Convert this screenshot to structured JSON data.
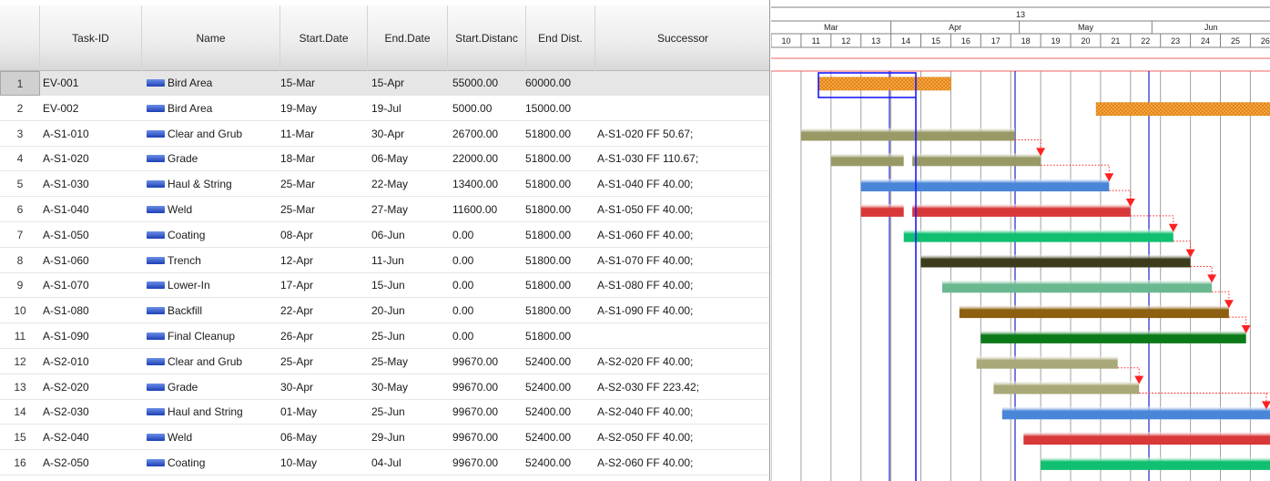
{
  "columns": {
    "task_id": "Task-ID",
    "name": "Name",
    "start_date": "Start.Date",
    "end_date": "End.Date",
    "start_dist": "Start.Distanc",
    "end_dist": "End Dist.",
    "successor": "Successor"
  },
  "timeline": {
    "year": "13",
    "months": [
      "Mar",
      "Apr",
      "May",
      "Jun"
    ],
    "weeks": [
      "10",
      "11",
      "12",
      "13",
      "14",
      "15",
      "16",
      "17",
      "18",
      "19",
      "20",
      "21",
      "22",
      "23",
      "24",
      "25",
      "26"
    ]
  },
  "rows": [
    {
      "num": "1",
      "task_id": "EV-001",
      "name": "Bird Area",
      "start": "15-Mar",
      "end": "15-Apr",
      "start_dist": "55000.00",
      "end_dist": "60000.00",
      "successor": ""
    },
    {
      "num": "2",
      "task_id": "EV-002",
      "name": "Bird Area",
      "start": "19-May",
      "end": "19-Jul",
      "start_dist": "5000.00",
      "end_dist": "15000.00",
      "successor": ""
    },
    {
      "num": "3",
      "task_id": "A-S1-010",
      "name": "Clear and Grub",
      "start": "11-Mar",
      "end": "30-Apr",
      "start_dist": "26700.00",
      "end_dist": "51800.00",
      "successor": "A-S1-020 FF 50.67;"
    },
    {
      "num": "4",
      "task_id": "A-S1-020",
      "name": "Grade",
      "start": "18-Mar",
      "end": "06-May",
      "start_dist": "22000.00",
      "end_dist": "51800.00",
      "successor": "A-S1-030 FF 110.67;"
    },
    {
      "num": "5",
      "task_id": "A-S1-030",
      "name": "Haul & String",
      "start": "25-Mar",
      "end": "22-May",
      "start_dist": "13400.00",
      "end_dist": "51800.00",
      "successor": "A-S1-040 FF 40.00;"
    },
    {
      "num": "6",
      "task_id": "A-S1-040",
      "name": "Weld",
      "start": "25-Mar",
      "end": "27-May",
      "start_dist": "11600.00",
      "end_dist": "51800.00",
      "successor": "A-S1-050 FF 40.00;"
    },
    {
      "num": "7",
      "task_id": "A-S1-050",
      "name": "Coating",
      "start": "08-Apr",
      "end": "06-Jun",
      "start_dist": "0.00",
      "end_dist": "51800.00",
      "successor": "A-S1-060 FF 40.00;"
    },
    {
      "num": "8",
      "task_id": "A-S1-060",
      "name": "Trench",
      "start": "12-Apr",
      "end": "11-Jun",
      "start_dist": "0.00",
      "end_dist": "51800.00",
      "successor": "A-S1-070 FF 40.00;"
    },
    {
      "num": "9",
      "task_id": "A-S1-070",
      "name": "Lower-In",
      "start": "17-Apr",
      "end": "15-Jun",
      "start_dist": "0.00",
      "end_dist": "51800.00",
      "successor": "A-S1-080 FF 40.00;"
    },
    {
      "num": "10",
      "task_id": "A-S1-080",
      "name": "Backfill",
      "start": "22-Apr",
      "end": "20-Jun",
      "start_dist": "0.00",
      "end_dist": "51800.00",
      "successor": "A-S1-090 FF 40.00;"
    },
    {
      "num": "11",
      "task_id": "A-S1-090",
      "name": "Final Cleanup",
      "start": "26-Apr",
      "end": "25-Jun",
      "start_dist": "0.00",
      "end_dist": "51800.00",
      "successor": ""
    },
    {
      "num": "12",
      "task_id": "A-S2-010",
      "name": "Clear and Grub",
      "start": "25-Apr",
      "end": "25-May",
      "start_dist": "99670.00",
      "end_dist": "52400.00",
      "successor": "A-S2-020 FF 40.00;"
    },
    {
      "num": "13",
      "task_id": "A-S2-020",
      "name": "Grade",
      "start": "30-Apr",
      "end": "30-May",
      "start_dist": "99670.00",
      "end_dist": "52400.00",
      "successor": "A-S2-030 FF 223.42;"
    },
    {
      "num": "14",
      "task_id": "A-S2-030",
      "name": "Haul and String",
      "start": "01-May",
      "end": "25-Jun",
      "start_dist": "99670.00",
      "end_dist": "52400.00",
      "successor": "A-S2-040 FF 40.00;"
    },
    {
      "num": "15",
      "task_id": "A-S2-040",
      "name": "Weld",
      "start": "06-May",
      "end": "29-Jun",
      "start_dist": "99670.00",
      "end_dist": "52400.00",
      "successor": "A-S2-050 FF 40.00;"
    },
    {
      "num": "16",
      "task_id": "A-S2-050",
      "name": "Coating",
      "start": "10-May",
      "end": "04-Jul",
      "start_dist": "99670.00",
      "end_dist": "52400.00",
      "successor": "A-S2-060 FF 40.00;"
    }
  ],
  "bars": [
    {
      "row": 0,
      "segments": [
        {
          "from": "15-Mar",
          "to": "15-Apr"
        }
      ],
      "color": "#f0a030",
      "style": "hatched"
    },
    {
      "row": 1,
      "segments": [
        {
          "from": "19-May",
          "to": "19-Jul"
        }
      ],
      "color": "#f0a030",
      "style": "hatched"
    },
    {
      "row": 2,
      "segments": [
        {
          "from": "11-Mar",
          "to": "30-Apr"
        }
      ],
      "color": "#999966"
    },
    {
      "row": 3,
      "segments": [
        {
          "from": "18-Mar",
          "to": "04-Apr"
        },
        {
          "from": "06-Apr",
          "to": "06-May"
        }
      ],
      "color": "#999966"
    },
    {
      "row": 4,
      "segments": [
        {
          "from": "25-Mar",
          "to": "22-May"
        }
      ],
      "color": "#4a86d8"
    },
    {
      "row": 5,
      "segments": [
        {
          "from": "25-Mar",
          "to": "04-Apr"
        },
        {
          "from": "06-Apr",
          "to": "27-May"
        }
      ],
      "color": "#d83838"
    },
    {
      "row": 6,
      "segments": [
        {
          "from": "04-Apr",
          "to": "06-Jun"
        }
      ],
      "color": "#10c070"
    },
    {
      "row": 7,
      "segments": [
        {
          "from": "08-Apr",
          "to": "10-Jun"
        }
      ],
      "color": "#3c3c1c"
    },
    {
      "row": 8,
      "segments": [
        {
          "from": "13-Apr",
          "to": "15-Jun"
        }
      ],
      "color": "#6ab890"
    },
    {
      "row": 9,
      "segments": [
        {
          "from": "17-Apr",
          "to": "19-Jun"
        }
      ],
      "color": "#8c6010"
    },
    {
      "row": 10,
      "segments": [
        {
          "from": "22-Apr",
          "to": "23-Jun"
        }
      ],
      "color": "#0c7a18"
    },
    {
      "row": 11,
      "segments": [
        {
          "from": "21-Apr",
          "to": "24-May"
        }
      ],
      "color": "#a8a878"
    },
    {
      "row": 12,
      "segments": [
        {
          "from": "25-Apr",
          "to": "29-May"
        }
      ],
      "color": "#a8a878"
    },
    {
      "row": 13,
      "segments": [
        {
          "from": "27-Apr",
          "to": "30-Jun"
        }
      ],
      "color": "#4a86d8"
    },
    {
      "row": 14,
      "segments": [
        {
          "from": "02-May",
          "to": "30-Jun"
        }
      ],
      "color": "#d83838"
    },
    {
      "row": 15,
      "segments": [
        {
          "from": "06-May",
          "to": "30-Jun"
        }
      ],
      "color": "#10c070"
    }
  ],
  "colors": {
    "link": "#ff2020",
    "today_line": "#2020cc",
    "selection": "#1a1aff",
    "grid_line": "#808080"
  }
}
